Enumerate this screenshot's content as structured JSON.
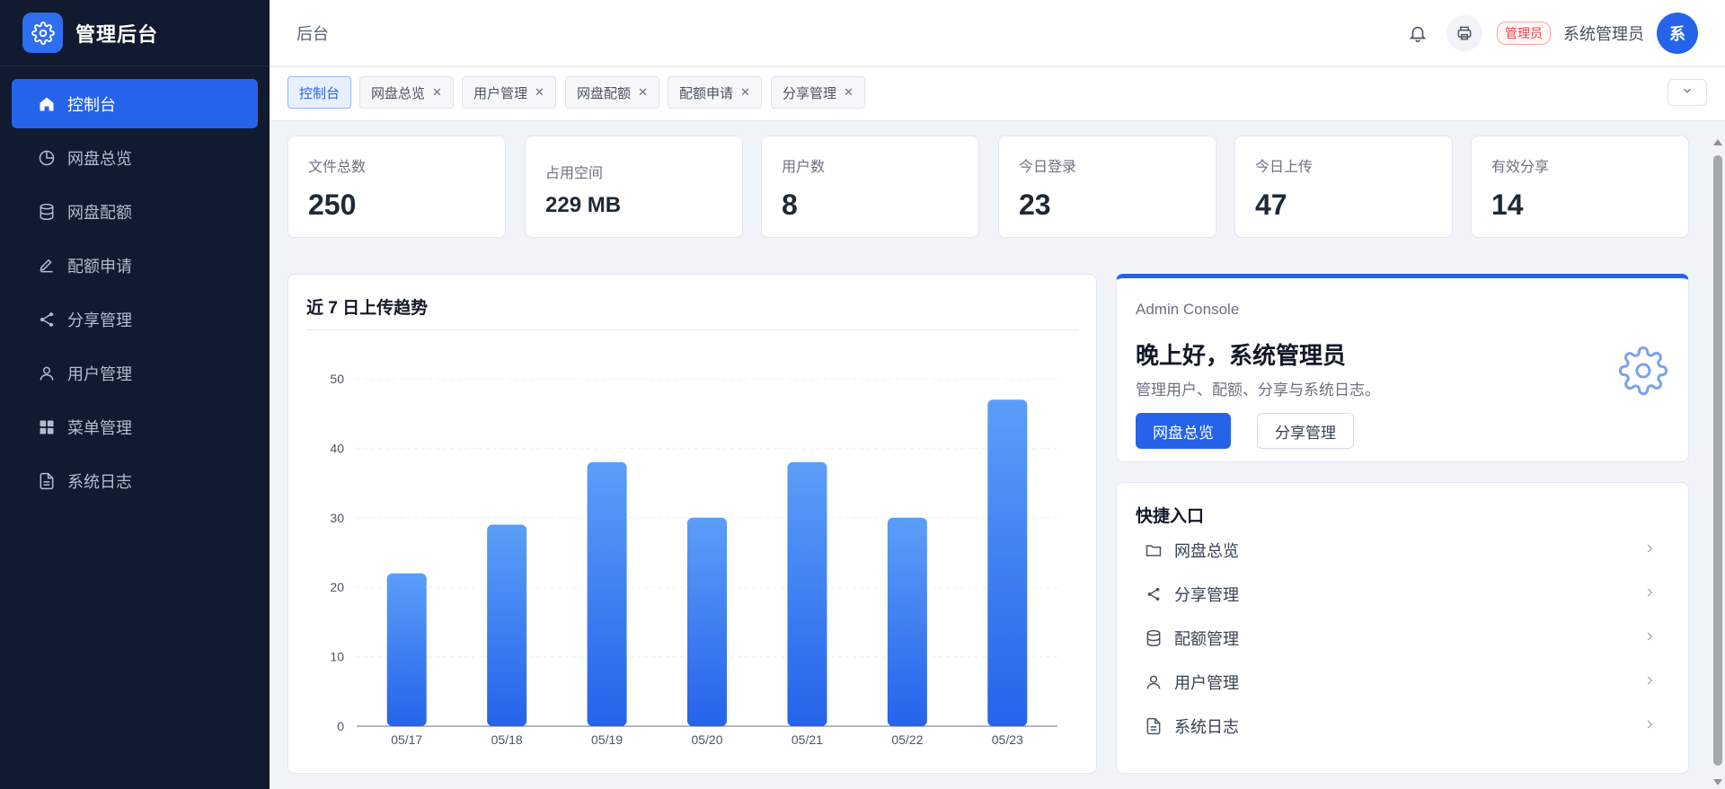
{
  "brand": {
    "title": "管理后台"
  },
  "sidebar": {
    "items": [
      {
        "label": "控制台",
        "icon": "home-icon",
        "active": true
      },
      {
        "label": "网盘总览",
        "icon": "pie-chart-icon"
      },
      {
        "label": "网盘配额",
        "icon": "database-icon"
      },
      {
        "label": "配额申请",
        "icon": "edit-icon"
      },
      {
        "label": "分享管理",
        "icon": "share-icon"
      },
      {
        "label": "用户管理",
        "icon": "user-icon"
      },
      {
        "label": "菜单管理",
        "icon": "grid-icon"
      },
      {
        "label": "系统日志",
        "icon": "file-text-icon"
      }
    ]
  },
  "header": {
    "breadcrumb": "后台",
    "role_badge": "管理员",
    "user_name": "系统管理员",
    "avatar_text": "系"
  },
  "tabs": [
    {
      "label": "控制台",
      "active": true,
      "closable": false
    },
    {
      "label": "网盘总览",
      "closable": true
    },
    {
      "label": "用户管理",
      "closable": true
    },
    {
      "label": "网盘配额",
      "closable": true
    },
    {
      "label": "配额申请",
      "closable": true
    },
    {
      "label": "分享管理",
      "closable": true
    }
  ],
  "stats": [
    {
      "label": "文件总数",
      "value": "250"
    },
    {
      "label": "占用空间",
      "value": "229 MB"
    },
    {
      "label": "用户数",
      "value": "8"
    },
    {
      "label": "今日登录",
      "value": "23"
    },
    {
      "label": "今日上传",
      "value": "47"
    },
    {
      "label": "有效分享",
      "value": "14"
    }
  ],
  "chart_data": {
    "type": "bar",
    "title": "近 7 日上传趋势",
    "categories": [
      "05/17",
      "05/18",
      "05/19",
      "05/20",
      "05/21",
      "05/22",
      "05/23"
    ],
    "values": [
      22,
      29,
      38,
      30,
      38,
      30,
      47
    ],
    "ylim": [
      0,
      50
    ],
    "yticks": [
      0,
      10,
      20,
      30,
      40,
      50
    ],
    "xlabel": "",
    "ylabel": "",
    "grid": true,
    "colors": {
      "bar_top": "#5b9ef8",
      "bar_bottom": "#2563eb"
    }
  },
  "welcome": {
    "eyebrow": "Admin Console",
    "title": "晚上好，系统管理员",
    "desc": "管理用户、配额、分享与系统日志。",
    "primary_btn": "网盘总览",
    "secondary_btn": "分享管理"
  },
  "quick": {
    "title": "快捷入口",
    "items": [
      {
        "label": "网盘总览",
        "icon": "folder-icon"
      },
      {
        "label": "分享管理",
        "icon": "share-icon"
      },
      {
        "label": "配额管理",
        "icon": "database-icon"
      },
      {
        "label": "用户管理",
        "icon": "user-icon"
      },
      {
        "label": "系统日志",
        "icon": "file-text-icon"
      }
    ]
  },
  "colors": {
    "accent": "#2563eb",
    "sidebar_bg": "#111a2e",
    "danger": "#e5484d"
  }
}
